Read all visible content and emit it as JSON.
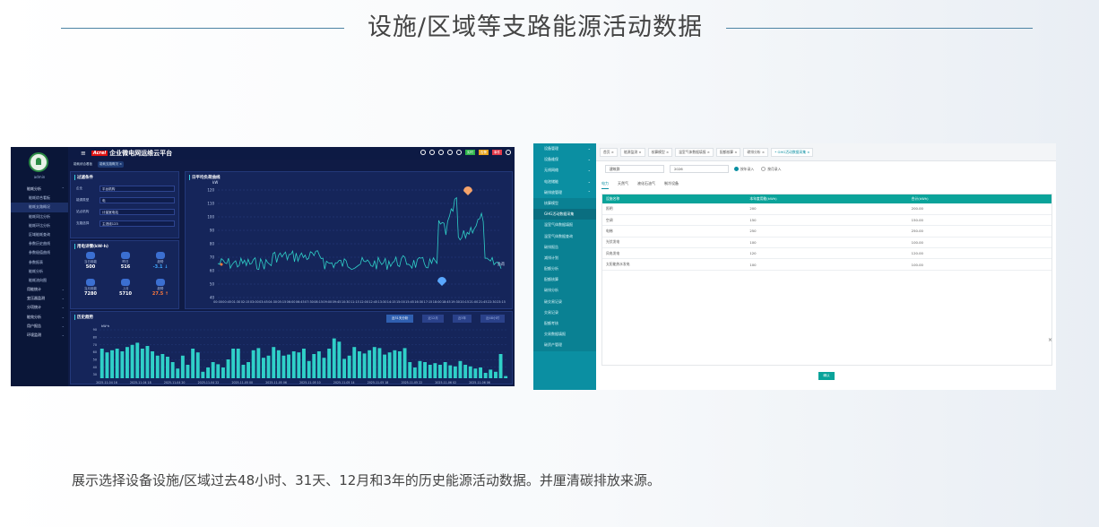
{
  "page": {
    "title": "设施/区域等支路能源活动数据",
    "caption": "展示选择设备设施/区域过去48小时、31天、12月和3年的历史能源活动数据。并厘清碳排放来源。"
  },
  "dashboard": {
    "brand_logo": "Acrel",
    "brand_title": "企业微电网运维云平台",
    "user": "admin",
    "top_tags": [
      {
        "label": "实时",
        "color": "#2db34a"
      },
      {
        "label": "告警",
        "color": "#e6a21c"
      },
      {
        "label": "事件",
        "color": "#e0394a"
      }
    ],
    "breadcrumbs": [
      "能耗综合看板",
      "能耗支路概况 ×"
    ],
    "menu": [
      {
        "label": "能耗分析",
        "type": "group",
        "chev": "^"
      },
      {
        "label": "能耗综合看板",
        "type": "item"
      },
      {
        "label": "能耗支路概况",
        "type": "item",
        "selected": true
      },
      {
        "label": "能耗同比分析",
        "type": "item"
      },
      {
        "label": "能耗环比分析",
        "type": "item"
      },
      {
        "label": "区域能耗查询",
        "type": "item"
      },
      {
        "label": "参数历史曲线",
        "type": "item"
      },
      {
        "label": "参数极值曲线",
        "type": "item"
      },
      {
        "label": "参数报表",
        "type": "item"
      },
      {
        "label": "能耗分析",
        "type": "item"
      },
      {
        "label": "能耗流向图",
        "type": "item"
      },
      {
        "label": "用能统计",
        "type": "group",
        "chev": "v"
      },
      {
        "label": "变压器监测",
        "type": "group",
        "chev": "v"
      },
      {
        "label": "分项统计",
        "type": "group",
        "chev": "v"
      },
      {
        "label": "能效分析",
        "type": "group",
        "chev": "v"
      },
      {
        "label": "用户报告",
        "type": "group",
        "chev": "v"
      },
      {
        "label": "环境监测",
        "type": "group",
        "chev": "v"
      }
    ],
    "filter": {
      "title": "过滤条件",
      "rows": [
        {
          "label": "企业",
          "value": "平台机构"
        },
        {
          "label": "能源类型",
          "value": "电"
        },
        {
          "label": "站点机构",
          "value": "计量室电站"
        },
        {
          "label": "支路选择",
          "value": "主进线123"
        }
      ]
    },
    "stats": {
      "title": "用电详情(kW·h)",
      "cells": [
        {
          "label": "当日用能",
          "value": "500"
        },
        {
          "label": "昨日",
          "value": "516"
        },
        {
          "label": "趋势",
          "value": "-3.1 ↓"
        },
        {
          "label": "当月用能",
          "value": "7280"
        },
        {
          "label": "上月",
          "value": "5710"
        },
        {
          "label": "趋势",
          "value": "27.5 ↑"
        }
      ]
    },
    "curve": {
      "title": "日平均负荷曲线",
      "unit": "kW",
      "legend": "负荷",
      "y_ticks": [
        "120",
        "110",
        "100",
        "90",
        "80",
        "70",
        "60",
        "50",
        "40"
      ],
      "x_ticks": [
        "00:00",
        "00:45",
        "01:30",
        "02:15",
        "03:00",
        "03:45",
        "04:30",
        "05:15",
        "06:00",
        "06:45",
        "07:30",
        "08:15",
        "09:00",
        "09:45",
        "10:30",
        "11:15",
        "12:00",
        "12:45",
        "13:30",
        "14:15",
        "15:00",
        "15:45",
        "16:30",
        "17:15",
        "18:00",
        "18:45",
        "19:30",
        "20:15",
        "21:00",
        "21:45",
        "22:30",
        "23:15"
      ]
    },
    "hist": {
      "title": "历史趋势",
      "unit": "kW·h",
      "tabs": [
        "近31天分析",
        "近12月",
        "近3年",
        "近48小时"
      ],
      "x_ticks": [
        "2025-11-04 16",
        "2025-11-04 18",
        "2025-11-04 20",
        "2025-11-04 22",
        "2025-11-05 00",
        "2025-11-05 06",
        "2025-11-05 10",
        "2025-11-05 14",
        "2025-11-05 18",
        "2025-11-05 22",
        "2025-11-06 02",
        "2025-11-06 06"
      ],
      "y_ticks": [
        "90",
        "80",
        "70",
        "60",
        "50",
        "40",
        "30"
      ]
    }
  },
  "ghg": {
    "menu": [
      {
        "label": "设备管理",
        "type": "group",
        "chev": "v"
      },
      {
        "label": "设备维保",
        "type": "group",
        "chev": "v"
      },
      {
        "label": "无线网络",
        "type": "group",
        "chev": "v"
      },
      {
        "label": "电池储能",
        "type": "group",
        "chev": "v"
      },
      {
        "label": "碳排放管理",
        "type": "group",
        "chev": "^"
      },
      {
        "label": "核算模型",
        "type": "sub"
      },
      {
        "label": "GHG活动数据采集",
        "type": "sub",
        "selected": true
      },
      {
        "label": "温室气体数据填报",
        "type": "sub"
      },
      {
        "label": "温室气体数据查询",
        "type": "sub"
      },
      {
        "label": "碳排报告",
        "type": "sub"
      },
      {
        "label": "减排计划",
        "type": "sub"
      },
      {
        "label": "配额分析",
        "type": "sub"
      },
      {
        "label": "配额核算",
        "type": "sub"
      },
      {
        "label": "碳排分析",
        "type": "sub"
      },
      {
        "label": "碳交易记录",
        "type": "sub"
      },
      {
        "label": "交易记录",
        "type": "sub"
      },
      {
        "label": "配额考核",
        "type": "sub"
      },
      {
        "label": "交易数据填报",
        "type": "sub"
      },
      {
        "label": "碳资产管理",
        "type": "sub"
      }
    ],
    "tabs": [
      "首页 ×",
      "能源监测 ×",
      "核算模型 ×",
      "温室气体数据填报 ×",
      "配额核算 ×",
      "碳排分析 ×",
      "• GHG活动数据采集 ×"
    ],
    "active_tab_index": 6,
    "building": "建筑群",
    "year": "2026",
    "radios": [
      {
        "label": "按年录入",
        "on": true
      },
      {
        "label": "按月录入",
        "on": false
      }
    ],
    "energy_tabs": [
      "电力",
      "天然气",
      "液化石油气",
      "制冷设备"
    ],
    "columns": [
      "设施名称",
      "本年度用能(kWh)",
      "合计(kWh)"
    ],
    "rows": [
      [
        "照明",
        "200",
        "200.00"
      ],
      [
        "空调",
        "150",
        "150.00"
      ],
      [
        "电梯",
        "250",
        "250.00"
      ],
      [
        "光伏发电",
        "100",
        "100.00"
      ],
      [
        "风电发电",
        "120",
        "120.00"
      ],
      [
        "太阳能热水发电",
        "100",
        "100.00"
      ]
    ],
    "confirm": "确认",
    "close": "×"
  },
  "colors": {
    "dash_bg": "#0f1b45",
    "accent_teal": "#0aa39a",
    "sidebar_teal": "#0b8fa2",
    "bar_color": "#2fd0c8",
    "line_color": "#2fd0c8"
  }
}
